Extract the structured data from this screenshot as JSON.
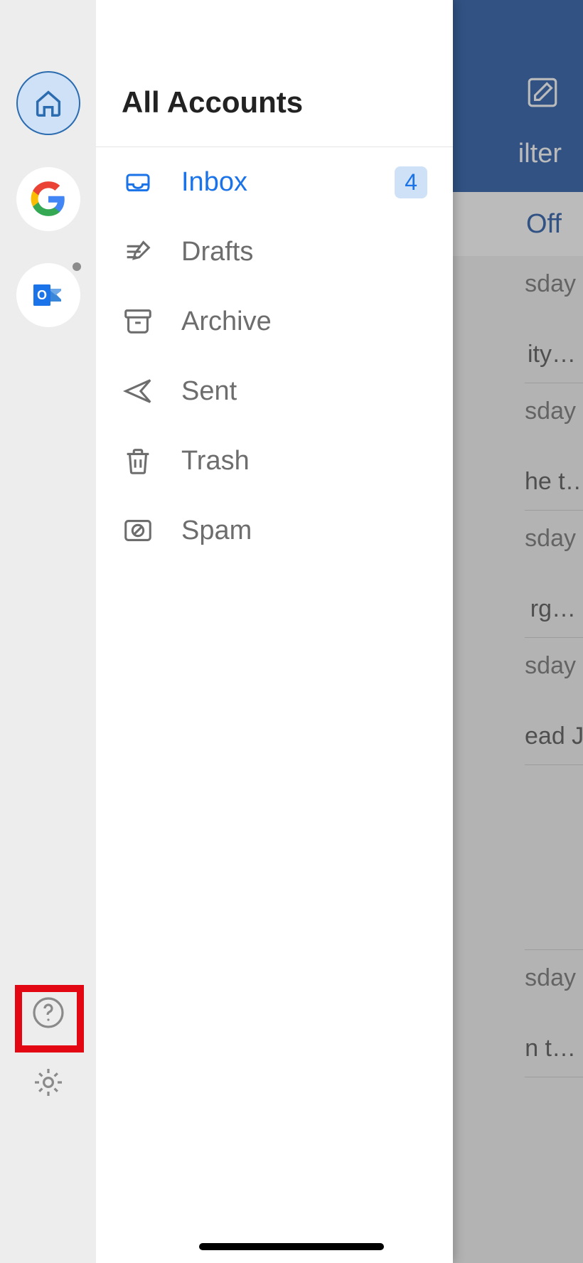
{
  "header": {
    "title": "All Accounts",
    "filter_label": "ilter",
    "toggle_off_label": "Off"
  },
  "accounts": {
    "home_name": "all-accounts",
    "google_name": "google-account",
    "outlook_name": "outlook-account"
  },
  "folders": [
    {
      "id": "inbox",
      "label": "Inbox",
      "icon": "inbox-icon",
      "active": true,
      "badge": "4"
    },
    {
      "id": "drafts",
      "label": "Drafts",
      "icon": "drafts-icon",
      "active": false,
      "badge": null
    },
    {
      "id": "archive",
      "label": "Archive",
      "icon": "archive-icon",
      "active": false,
      "badge": null
    },
    {
      "id": "sent",
      "label": "Sent",
      "icon": "sent-icon",
      "active": false,
      "badge": null
    },
    {
      "id": "trash",
      "label": "Trash",
      "icon": "trash-icon",
      "active": false,
      "badge": null
    },
    {
      "id": "spam",
      "label": "Spam",
      "icon": "spam-icon",
      "active": false,
      "badge": null
    }
  ],
  "bg_messages": [
    {
      "day": "sday",
      "snip": "ity…"
    },
    {
      "day": "sday",
      "snip": "he\nt…"
    },
    {
      "day": "sday",
      "snip": "rg…"
    },
    {
      "day": "sday",
      "snip": "ead\nJR…"
    },
    {
      "day": "sday",
      "snip": "n t…"
    }
  ],
  "footer": {
    "help_name": "help-button",
    "settings_name": "settings-button"
  }
}
